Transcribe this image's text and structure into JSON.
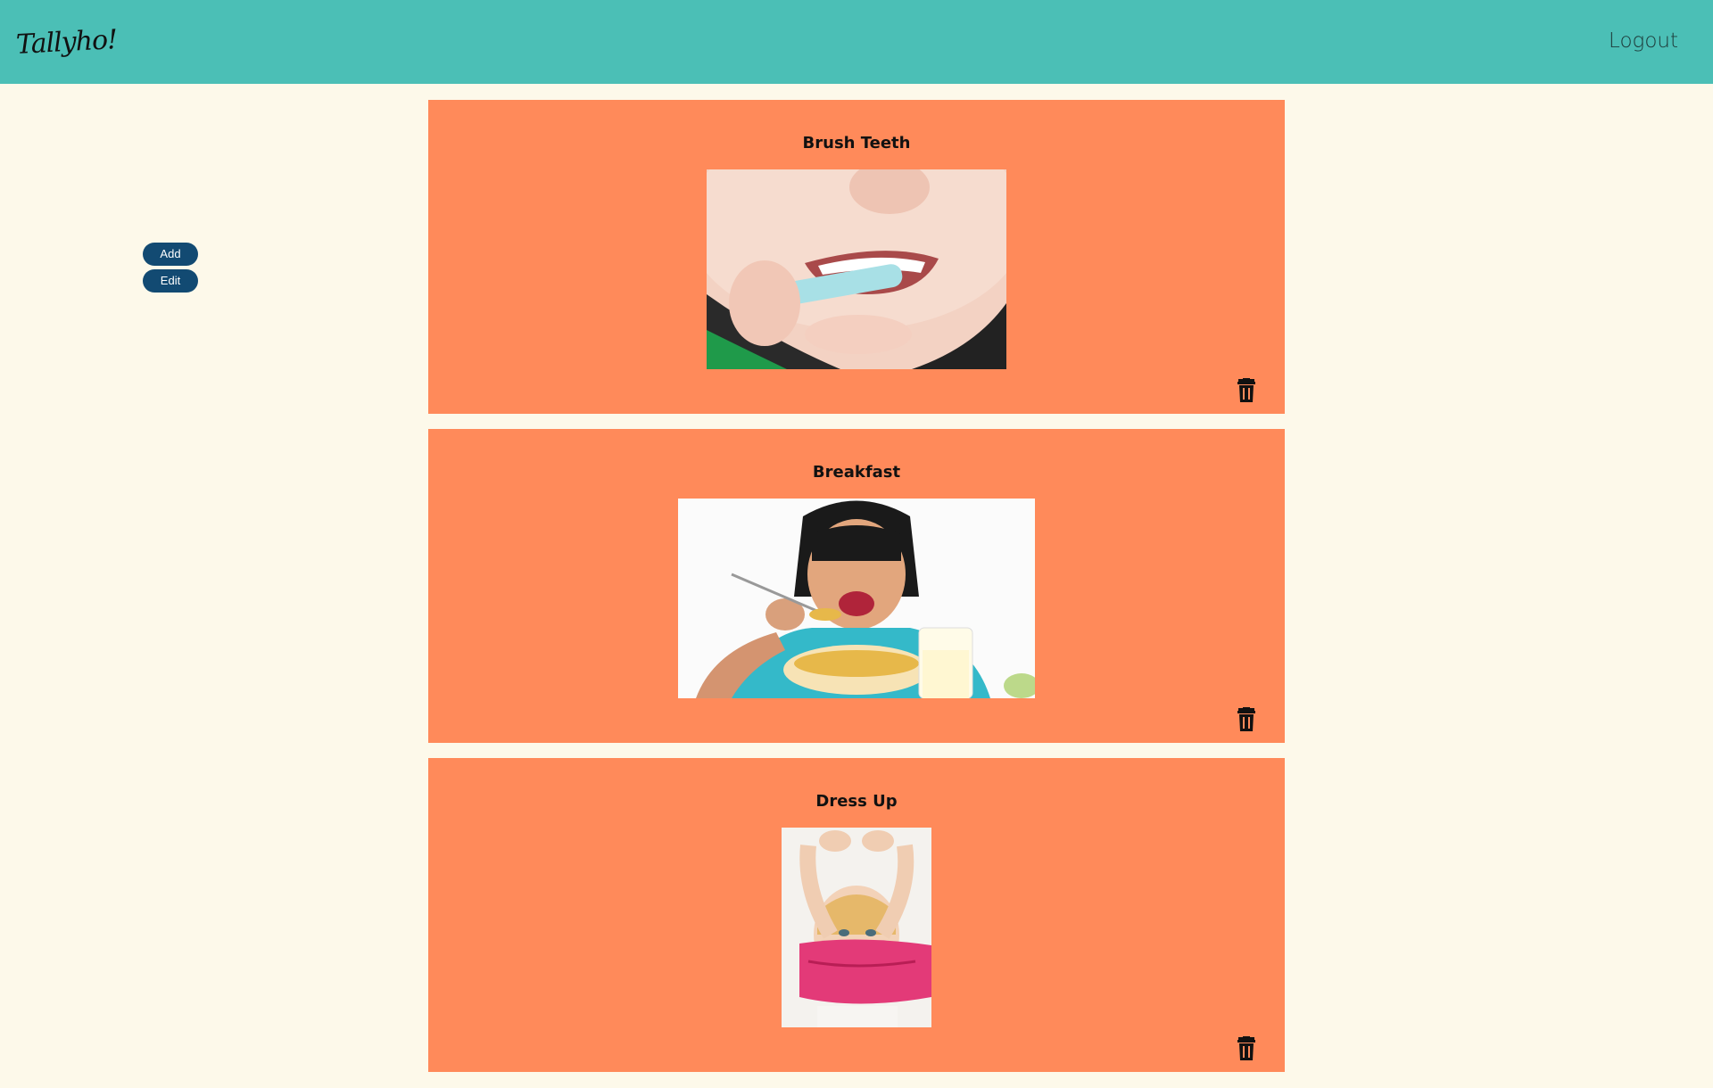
{
  "header": {
    "logo_text": "Tallyho!",
    "logout_label": "Logout"
  },
  "actions": {
    "add_label": "Add",
    "edit_label": "Edit"
  },
  "tasks": [
    {
      "title": "Brush Teeth",
      "image_alt": "child brushing teeth"
    },
    {
      "title": "Breakfast",
      "image_alt": "girl eating cereal"
    },
    {
      "title": "Dress Up",
      "image_alt": "child pulling on a pink shirt"
    }
  ],
  "colors": {
    "header": "#4bbfb6",
    "background": "#fdf9ea",
    "card": "#ff8a5a",
    "button": "#124a72"
  },
  "icons": {
    "delete": "trash-icon"
  }
}
